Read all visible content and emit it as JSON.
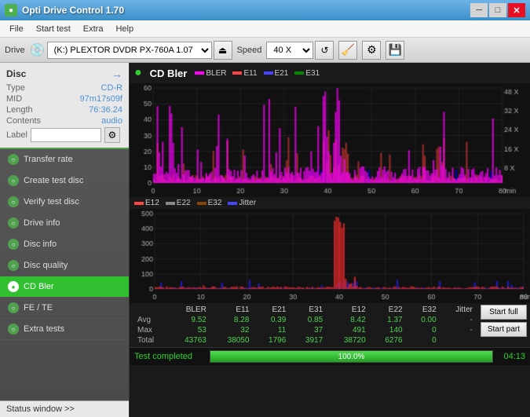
{
  "titleBar": {
    "title": "Opti Drive Control 1.70",
    "icon": "disc-icon"
  },
  "menuBar": {
    "items": [
      "File",
      "Start test",
      "Extra",
      "Help"
    ]
  },
  "toolbar": {
    "driveLabel": "Drive",
    "driveName": "(K:)  PLEXTOR DVDR  PX-760A 1.07",
    "speedLabel": "Speed",
    "speedValue": "40 X"
  },
  "disc": {
    "title": "Disc",
    "type": {
      "label": "Type",
      "value": "CD-R"
    },
    "mid": {
      "label": "MID",
      "value": "97m17s09f"
    },
    "length": {
      "label": "Length",
      "value": "76:36.24"
    },
    "contents": {
      "label": "Contents",
      "value": "audio"
    },
    "labelField": {
      "label": "Label",
      "value": ""
    }
  },
  "sidebar": {
    "items": [
      {
        "id": "transfer-rate",
        "label": "Transfer rate",
        "active": false
      },
      {
        "id": "create-test-disc",
        "label": "Create test disc",
        "active": false
      },
      {
        "id": "verify-test-disc",
        "label": "Verify test disc",
        "active": false
      },
      {
        "id": "drive-info",
        "label": "Drive info",
        "active": false
      },
      {
        "id": "disc-info",
        "label": "Disc info",
        "active": false
      },
      {
        "id": "disc-quality",
        "label": "Disc quality",
        "active": false
      },
      {
        "id": "cd-bler",
        "label": "CD Bler",
        "active": true
      },
      {
        "id": "fe-te",
        "label": "FE / TE",
        "active": false
      },
      {
        "id": "extra-tests",
        "label": "Extra tests",
        "active": false
      }
    ],
    "statusWindow": "Status window >>"
  },
  "chart1": {
    "title": "CD Bler",
    "legend": [
      {
        "label": "BLER",
        "color": "#ff00ff"
      },
      {
        "label": "E11",
        "color": "#ff4444"
      },
      {
        "label": "E21",
        "color": "#4444ff"
      },
      {
        "label": "E31",
        "color": "#008800"
      }
    ],
    "yMax": 60,
    "yLabels": [
      "60",
      "40",
      "20",
      "0"
    ],
    "xLabels": [
      "0",
      "10",
      "20",
      "30",
      "40",
      "50",
      "60",
      "70",
      "80"
    ],
    "xUnit": "min",
    "rightLabels": [
      "48 X",
      "32 X",
      "24 X",
      "16 X",
      "8 X"
    ]
  },
  "chart2": {
    "legend": [
      {
        "label": "E12",
        "color": "#ff4444"
      },
      {
        "label": "E22",
        "color": "#888888"
      },
      {
        "label": "E32",
        "color": "#884400"
      },
      {
        "label": "Jitter",
        "color": "#4444ff"
      }
    ],
    "yMax": 500,
    "yLabels": [
      "500",
      "400",
      "300",
      "200",
      "100",
      "0"
    ],
    "xLabels": [
      "0",
      "10",
      "20",
      "30",
      "40",
      "50",
      "60",
      "70",
      "80"
    ],
    "xUnit": "min"
  },
  "stats": {
    "headers": [
      "BLER",
      "E11",
      "E21",
      "E31",
      "E12",
      "E22",
      "E32",
      "Jitter"
    ],
    "rows": [
      {
        "label": "Avg",
        "values": [
          "9.52",
          "8.28",
          "0.39",
          "0.85",
          "8.42",
          "1.37",
          "0.00",
          "-"
        ]
      },
      {
        "label": "Max",
        "values": [
          "53",
          "32",
          "11",
          "37",
          "491",
          "140",
          "0",
          "-"
        ]
      },
      {
        "label": "Total",
        "values": [
          "43763",
          "38050",
          "1796",
          "3917",
          "38720",
          "6276",
          "0",
          ""
        ]
      }
    ],
    "buttons": [
      "Start full",
      "Start part"
    ]
  },
  "statusBar": {
    "text": "Test completed",
    "progress": 100.0,
    "progressText": "100.0%",
    "time": "04:13"
  },
  "colors": {
    "accent": "#30c030",
    "chartBg": "#111111",
    "bler": "#ff00ff",
    "e11": "#ff4444",
    "e21": "#4444ff",
    "e31": "#008800",
    "e12": "#ff3333",
    "e22": "#888888",
    "e32": "#884400",
    "jitter": "#3333ff"
  }
}
